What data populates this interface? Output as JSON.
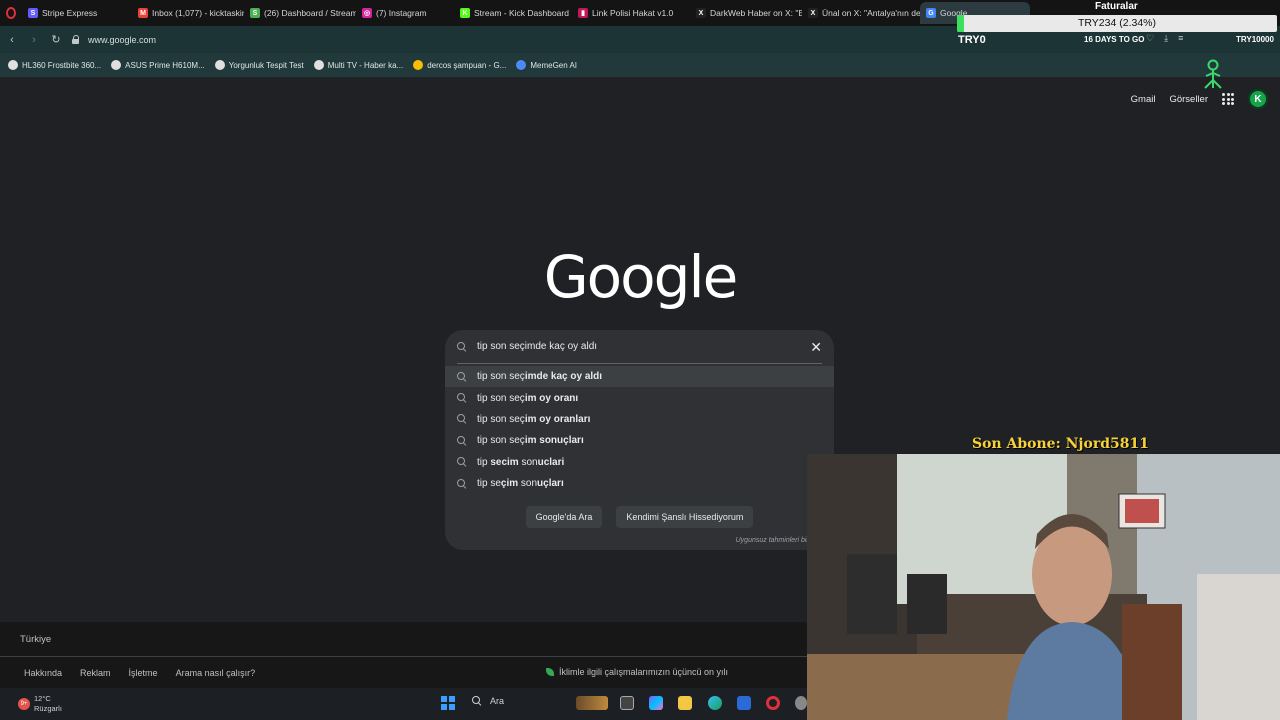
{
  "tabs": [
    {
      "label": "Stripe Express",
      "color": "#635bff",
      "glyph": "S"
    },
    {
      "label": "Inbox (1,077) - kicktaskine",
      "color": "#ea4335",
      "glyph": "M"
    },
    {
      "label": "(26) Dashboard / Streamla",
      "color": "#4caf50",
      "glyph": "S"
    },
    {
      "label": "(7) Instagram",
      "color": "#d6249f",
      "glyph": "◎"
    },
    {
      "label": "Stream - Kick Dashboard",
      "color": "#53fc18",
      "glyph": "K"
    },
    {
      "label": "Link Polisi Hakat v1.0",
      "color": "#c2185b",
      "glyph": "▮"
    },
    {
      "label": "DarkWeb Haber on X: \"Ep",
      "color": "#222222",
      "glyph": "X"
    },
    {
      "label": "Ünal on X: \"Antalya'nın de",
      "color": "#222222",
      "glyph": "X"
    },
    {
      "label": "Google",
      "color": "#4285f4",
      "glyph": "G",
      "active": true
    }
  ],
  "address": {
    "url": "www.google.com"
  },
  "bookmarks": [
    {
      "label": "HL360 Frostbite 360...",
      "color": "#e0e0e0"
    },
    {
      "label": "ASUS Prime H610M...",
      "color": "#e0e0e0"
    },
    {
      "label": "Yorgunluk Tespit Test",
      "color": "#e0e0e0"
    },
    {
      "label": "Multi TV - Haber ka...",
      "color": "#e0e0e0"
    },
    {
      "label": "dercos şampuan - G...",
      "color": "#fbbc05"
    },
    {
      "label": "MemeGen AI",
      "color": "#4c8bf5"
    }
  ],
  "overlay": {
    "goal_title": "Faturalar",
    "goal_text": "TRY234 (2.34%)",
    "goal_progress": 0.0234,
    "goal_min": "TRY0",
    "goal_days": "16 DAYS TO GO",
    "goal_max": "TRY10000",
    "subscriber": "Son Abone: Njord5811"
  },
  "google": {
    "links": [
      "Gmail",
      "Görseller"
    ],
    "avatar_letter": "K",
    "logo": "Google",
    "query": "tip son seçimde kaç oy aldı",
    "suggestions": [
      {
        "prefix": "tip son seç",
        "bold": "imde kaç oy aldı"
      },
      {
        "prefix": "tip son seç",
        "bold": "im oy oranı"
      },
      {
        "prefix": "tip son seç",
        "bold": "im oy oranları"
      },
      {
        "prefix": "tip son seç",
        "bold": "im sonuçları"
      },
      {
        "prefix": "tip ",
        "bold": "secim",
        "suffix": " son",
        "bold2": "uclari"
      },
      {
        "prefix": "tip se",
        "bold": "çim",
        "suffix": " son",
        "bold2": "uçları"
      }
    ],
    "search_button": "Google'da Ara",
    "lucky_button": "Kendimi Şanslı Hissediyorum",
    "report": "Uygunsuz tahminleri bil",
    "country": "Türkiye",
    "footer_links": [
      "Hakkında",
      "Reklam",
      "İşletme",
      "Arama nasıl çalışır?"
    ],
    "eco_text": "İklimle ilgili çalışmalarımızın üçüncü on yılı"
  },
  "taskbar": {
    "weather_temp": "12°C",
    "weather_desc": "Rüzgarlı",
    "weather_badge": "9+",
    "search_label": "Ara"
  }
}
